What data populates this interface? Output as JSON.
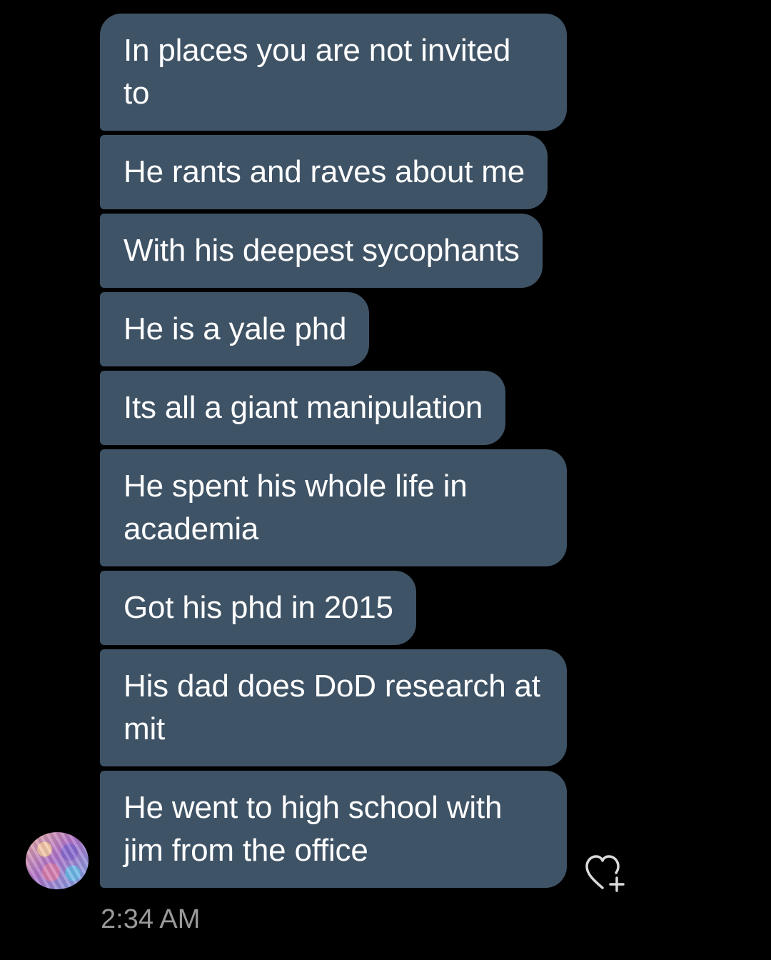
{
  "messages": [
    {
      "text": "In places you are not invited to"
    },
    {
      "text": "He rants and raves about me"
    },
    {
      "text": "With his deepest sycophants"
    },
    {
      "text": "He is a yale phd"
    },
    {
      "text": "Its all a giant manipulation"
    },
    {
      "text": "He spent his whole life in academia"
    },
    {
      "text": "Got his phd in 2015"
    },
    {
      "text": "His dad does DoD research at mit"
    },
    {
      "text": "He went to high school with jim from the office"
    }
  ],
  "timestamp": "2:34 AM",
  "icons": {
    "avatar": "avatar-image",
    "react": "heart-plus-icon"
  },
  "colors": {
    "background": "#000000",
    "bubble": "#3f5366",
    "bubble_text": "#ffffff",
    "timestamp": "#9a9a9a",
    "icon": "#d9d9d9"
  }
}
